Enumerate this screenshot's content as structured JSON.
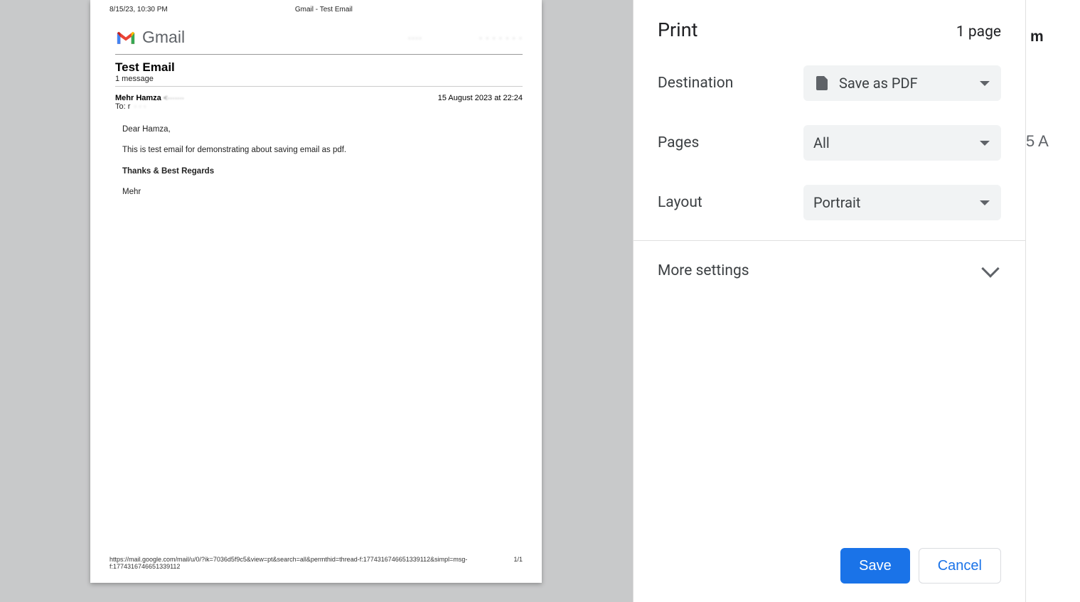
{
  "preview": {
    "header_date": "8/15/23, 10:30 PM",
    "header_title": "Gmail - Test Email",
    "gmail_label": "Gmail",
    "user_blur_left": "····",
    "user_blur_right": "· · · · · · ·",
    "subject": "Test Email",
    "message_count": "1 message",
    "sender_name": "Mehr Hamza",
    "sender_email_blur": "<·······",
    "sent_datetime": "15 August 2023 at 22:24",
    "to_label": "To: r",
    "to_blur": "· · ·",
    "body": {
      "greeting": "Dear Hamza,",
      "line1": "This is test email for demonstrating about saving email as pdf.",
      "regards": "Thanks & Best Regards",
      "signature": "Mehr"
    },
    "footer_url": "https://mail.google.com/mail/u/0/?ik=7036d5f9c5&view=pt&search=all&permthid=thread-f:1774316746651339112&simpl=msg-f:1774316746651339112",
    "footer_page": "1/1"
  },
  "panel": {
    "title": "Print",
    "page_count": "1 page",
    "destination_label": "Destination",
    "destination_value": "Save as PDF",
    "pages_label": "Pages",
    "pages_value": "All",
    "layout_label": "Layout",
    "layout_value": "Portrait",
    "more_settings": "More settings",
    "save": "Save",
    "cancel": "Cancel"
  },
  "bg": {
    "frag1": "m",
    "frag2": "5 A"
  }
}
